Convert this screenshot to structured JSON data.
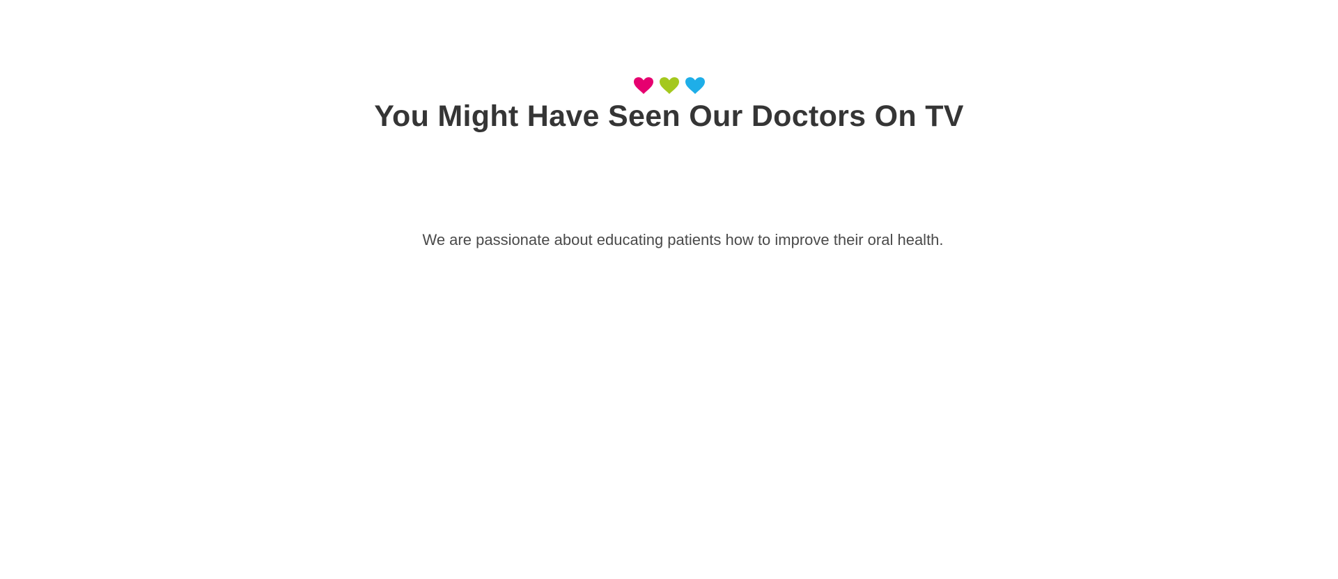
{
  "hero": {
    "hearts": [
      {
        "icon": "heart-icon",
        "color": "#e6006f"
      },
      {
        "icon": "heart-icon",
        "color": "#a4c81e"
      },
      {
        "icon": "heart-icon",
        "color": "#1eaee8"
      }
    ],
    "title": "You Might Have Seen Our Doctors On TV",
    "subtitle": "We are passionate about educating patients how to improve their oral health."
  }
}
